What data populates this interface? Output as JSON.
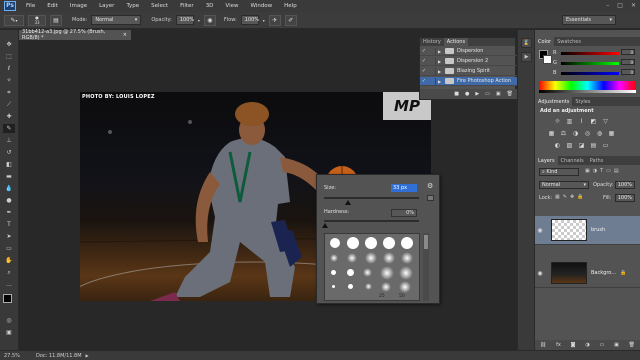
{
  "app": {
    "logo": "Ps"
  },
  "menu": [
    "File",
    "Edit",
    "Image",
    "Layer",
    "Type",
    "Select",
    "Filter",
    "3D",
    "View",
    "Window",
    "Help"
  ],
  "window_controls": [
    "–",
    "□",
    "✕"
  ],
  "options_bar": {
    "mode_label": "Mode:",
    "mode_value": "Normal",
    "opacity_label": "Opacity:",
    "opacity_value": "100%",
    "flow_label": "Flow:",
    "flow_value": "100%",
    "brush_size": "33",
    "workspace": "Essentials"
  },
  "document_tab": {
    "title": "31bb412-a3.jpg @ 27.5% (Brush, RGB/8) *",
    "close": "×"
  },
  "photo": {
    "credit": "PHOTO BY: LOUIS LOPEZ",
    "logo_text": "MP"
  },
  "brush_popup": {
    "size_label": "Size:",
    "size_value": "33 px",
    "hardness_label": "Hardness:",
    "hardness_value": "0%",
    "preset_numbers": [
      "25",
      "50"
    ]
  },
  "panel_history_actions": {
    "tabs": [
      "History",
      "Actions"
    ],
    "actions": [
      "Dispersion",
      "Dispersion 2",
      "Blazing Spirit",
      "Fire Photoshop Action"
    ]
  },
  "color_panel": {
    "tabs": [
      "Color",
      "Swatches"
    ],
    "channels": [
      {
        "name": "R",
        "value": "0",
        "color": "#d33"
      },
      {
        "name": "G",
        "value": "0",
        "color": "#3c3"
      },
      {
        "name": "B",
        "value": "0",
        "color": "#33d"
      }
    ]
  },
  "adjustments_panel": {
    "tabs": [
      "Adjustments",
      "Styles"
    ],
    "heading": "Add an adjustment"
  },
  "layers_panel": {
    "tabs": [
      "Layers",
      "Channels",
      "Paths"
    ],
    "kind_label": "Kind",
    "blend_mode": "Normal",
    "opacity_label": "Opacity:",
    "opacity_value": "100%",
    "lock_label": "Lock:",
    "fill_label": "Fill:",
    "fill_value": "100%",
    "layers": [
      {
        "name": "brush",
        "selected": true
      },
      {
        "name": "Backgro...",
        "selected": false
      }
    ]
  },
  "status": {
    "zoom": "27.5%",
    "doc_info": "Doc: 11.8M/11.8M"
  }
}
